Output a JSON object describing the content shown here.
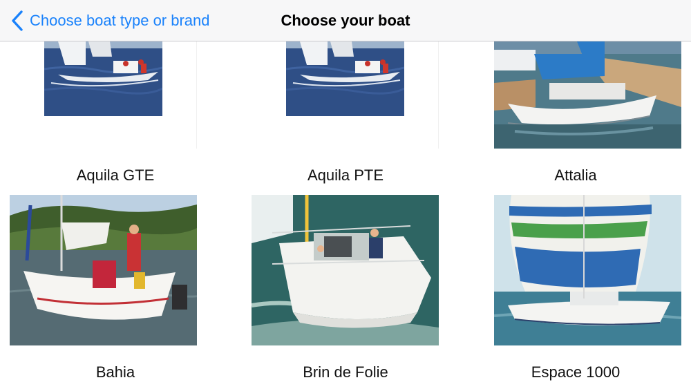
{
  "navbar": {
    "back_label": "Choose boat type or brand",
    "title": "Choose your boat"
  },
  "boats": [
    {
      "name": "Aquila GTE"
    },
    {
      "name": "Aquila PTE"
    },
    {
      "name": "Attalia"
    },
    {
      "name": "Bahia"
    },
    {
      "name": "Brin de Folie"
    },
    {
      "name": "Espace 1000"
    }
  ],
  "colors": {
    "accent": "#1a82fb",
    "navbar_bg": "#f7f7f8"
  }
}
